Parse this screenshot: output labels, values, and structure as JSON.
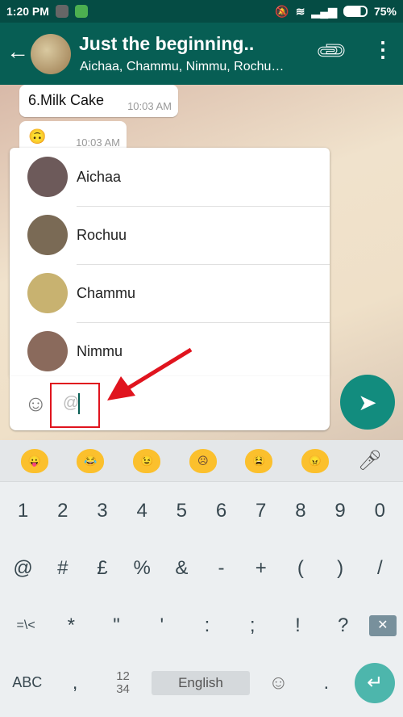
{
  "status": {
    "time": "1:20 PM",
    "battery": "75%"
  },
  "header": {
    "title": "Just the beginning..",
    "subtitle": "Aichaa, Chammu, Nimmu, Rochu…"
  },
  "messages": [
    {
      "text": "6.Milk Cake",
      "time": "10:03 AM"
    },
    {
      "text": "🙃",
      "time": "10:03 AM"
    }
  ],
  "mentions": [
    {
      "name": "Aichaa",
      "color": "#6d5a5a"
    },
    {
      "name": "Rochuu",
      "color": "#7a6a55"
    },
    {
      "name": "Chammu",
      "color": "#c8b270"
    },
    {
      "name": "Nimmu",
      "color": "#8a6a5c"
    }
  ],
  "input": {
    "value": "@"
  },
  "keyboard": {
    "emoji": [
      "😛",
      "😂",
      "😉",
      "☹",
      "😫",
      "😠"
    ],
    "row1": [
      "1",
      "2",
      "3",
      "4",
      "5",
      "6",
      "7",
      "8",
      "9",
      "0"
    ],
    "row2": [
      "@",
      "#",
      "£",
      "%",
      "&",
      "-",
      "+",
      "(",
      ")",
      "/"
    ],
    "row3": [
      "=\\<",
      "*",
      "\"",
      "'",
      ":",
      ";",
      "!",
      "?"
    ],
    "abc": "ABC",
    "comma": ",",
    "numpad": "12\n34",
    "space": "English",
    "period": "."
  },
  "colors": {
    "header": "#075e54",
    "send": "#128c7e",
    "highlight": "#e0141e",
    "enter": "#4db6ac"
  }
}
